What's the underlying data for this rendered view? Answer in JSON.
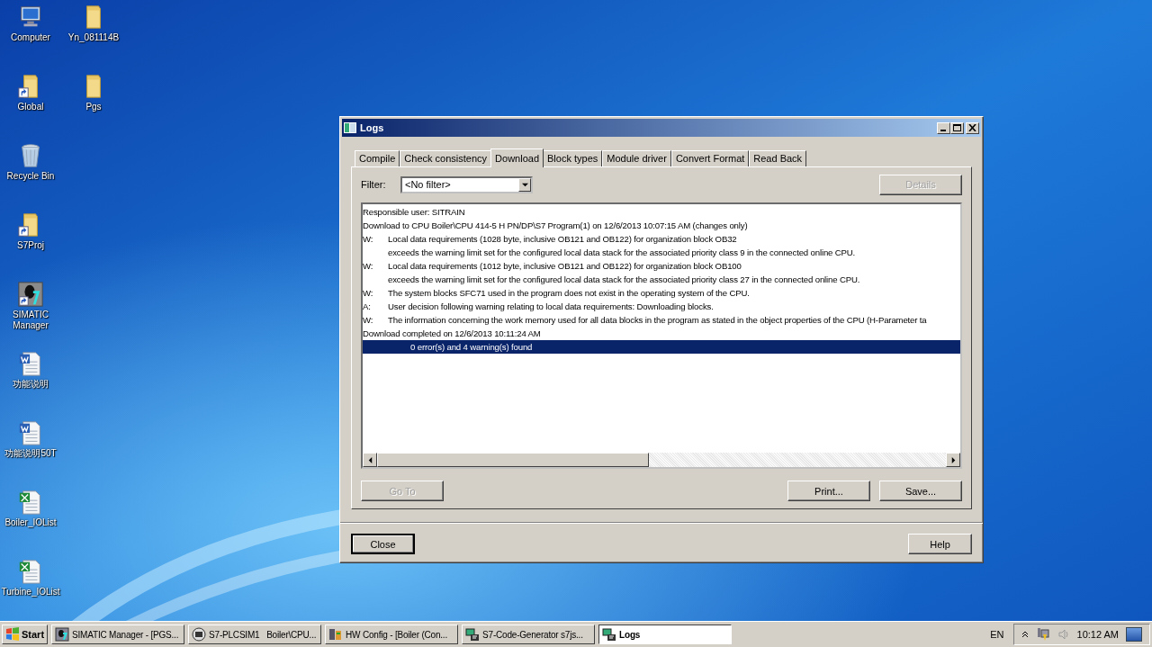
{
  "desktop": {
    "columns": [
      [
        {
          "label": "Computer",
          "kind": "computer"
        },
        {
          "label": "Global",
          "kind": "folder-shortcut"
        },
        {
          "label": "Recycle Bin",
          "kind": "recycle"
        },
        {
          "label": "S7Proj",
          "kind": "folder-shortcut"
        },
        {
          "label": "SIMATIC Manager",
          "kind": "app"
        },
        {
          "label": "功能说明",
          "kind": "word"
        },
        {
          "label": "功能说明50T",
          "kind": "word"
        },
        {
          "label": "Boiler_IOList",
          "kind": "excel"
        },
        {
          "label": "Turbine_IOList",
          "kind": "excel"
        }
      ],
      [
        {
          "label": "Yn_081114B",
          "kind": "folder"
        },
        {
          "label": "Pgs",
          "kind": "folder"
        }
      ]
    ]
  },
  "window": {
    "title": "Logs",
    "tabs": [
      {
        "label": "Compile",
        "selected": false
      },
      {
        "label": "Check consistency",
        "selected": false
      },
      {
        "label": "Download",
        "selected": true
      },
      {
        "label": "Block types",
        "selected": false
      },
      {
        "label": "Module driver",
        "selected": false
      },
      {
        "label": "Convert Format",
        "selected": false
      },
      {
        "label": "Read Back",
        "selected": false
      }
    ],
    "filter": {
      "label": "Filter:",
      "value": "<No filter>"
    },
    "details_button": {
      "label": "Details",
      "disabled": true
    },
    "log": [
      {
        "kind": "plain",
        "text": "Responsible user: SITRAIN",
        "selected": false
      },
      {
        "kind": "plain",
        "text": "Download to CPU Boiler\\CPU 414-5 H PN/DP\\S7 Program(1) on 12/6/2013 10:07:15 AM (changes only)",
        "selected": false
      },
      {
        "kind": "message",
        "prefix": "W:",
        "text": "Local data requirements (1028 byte, inclusive OB121 and OB122) for organization block OB32",
        "selected": false
      },
      {
        "kind": "continuation",
        "text": "exceeds the warning limit set for the configured local data stack for the associated priority class 9 in the connected online CPU.",
        "selected": false
      },
      {
        "kind": "message",
        "prefix": "W:",
        "text": "Local data requirements (1012 byte, inclusive OB121 and OB122) for organization block OB100",
        "selected": false
      },
      {
        "kind": "continuation",
        "text": "exceeds the warning limit set for the configured local data stack for the associated priority class 27 in the connected online CPU.",
        "selected": false
      },
      {
        "kind": "message",
        "prefix": "W:",
        "text": "The system blocks SFC71 used in the program does not exist in the operating system of the CPU.",
        "selected": false
      },
      {
        "kind": "message",
        "prefix": "A:",
        "text": "User decision following warning relating to local data requirements: Downloading blocks.",
        "selected": false
      },
      {
        "kind": "message",
        "prefix": "W:",
        "text": "The information concerning the work memory used for all data blocks in the program as stated in the object properties of the CPU (H-Parameter ta",
        "selected": false
      },
      {
        "kind": "plain",
        "text": "Download completed on 12/6/2013 10:11:24 AM",
        "selected": false
      },
      {
        "kind": "summary",
        "text": "0 error(s) and 4 warning(s) found",
        "selected": true
      }
    ],
    "buttons": [
      {
        "label": "Go To",
        "disabled": true
      },
      {
        "label": "Print...",
        "disabled": false
      },
      {
        "label": "Save...",
        "disabled": false
      }
    ],
    "footer_buttons": [
      {
        "label": "Close",
        "default": true
      },
      {
        "label": "Help",
        "default": false
      }
    ]
  },
  "taskbar": {
    "start": "Start",
    "tasks": [
      {
        "label": "SIMATIC Manager - [PGS...",
        "selected": false
      },
      {
        "label": "S7-PLCSIM1   Boiler\\CPU...",
        "selected": false
      },
      {
        "label": "HW Config - [Boiler (Con...",
        "selected": false
      },
      {
        "label": "S7-Code-Generator s7js...",
        "selected": false
      },
      {
        "label": "Logs",
        "selected": true
      }
    ],
    "language": "EN",
    "time": "10:12 AM"
  }
}
